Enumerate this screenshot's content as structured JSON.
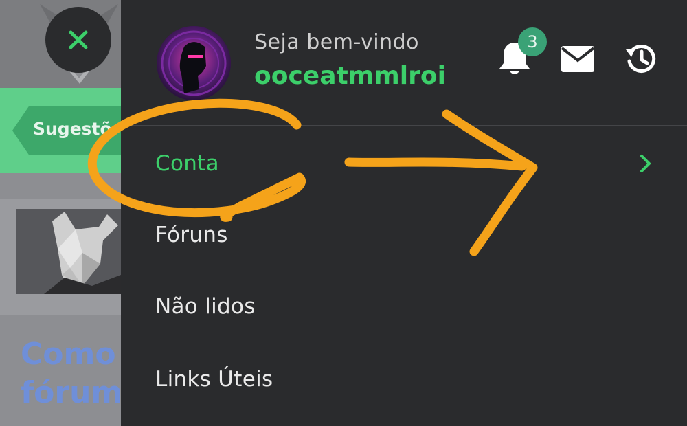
{
  "background_page": {
    "pill_label": "Sugestõ",
    "title": "Como\nfórum"
  },
  "header": {
    "welcome_text": "Seja bem-vindo",
    "username": "ooceatmmlroi",
    "notification_count": "3",
    "icons": [
      "bell-icon",
      "mail-icon",
      "history-icon"
    ]
  },
  "menu": {
    "items": [
      {
        "label": "Conta",
        "active": true
      },
      {
        "label": "Fóruns"
      },
      {
        "label": "Não lidos"
      },
      {
        "label": "Links Úteis"
      }
    ]
  },
  "colors": {
    "accent_green": "#3ccf6a",
    "drawer_bg": "#2a2b2d",
    "badge_bg": "#3aa276",
    "annotation": "#f5a31a"
  }
}
